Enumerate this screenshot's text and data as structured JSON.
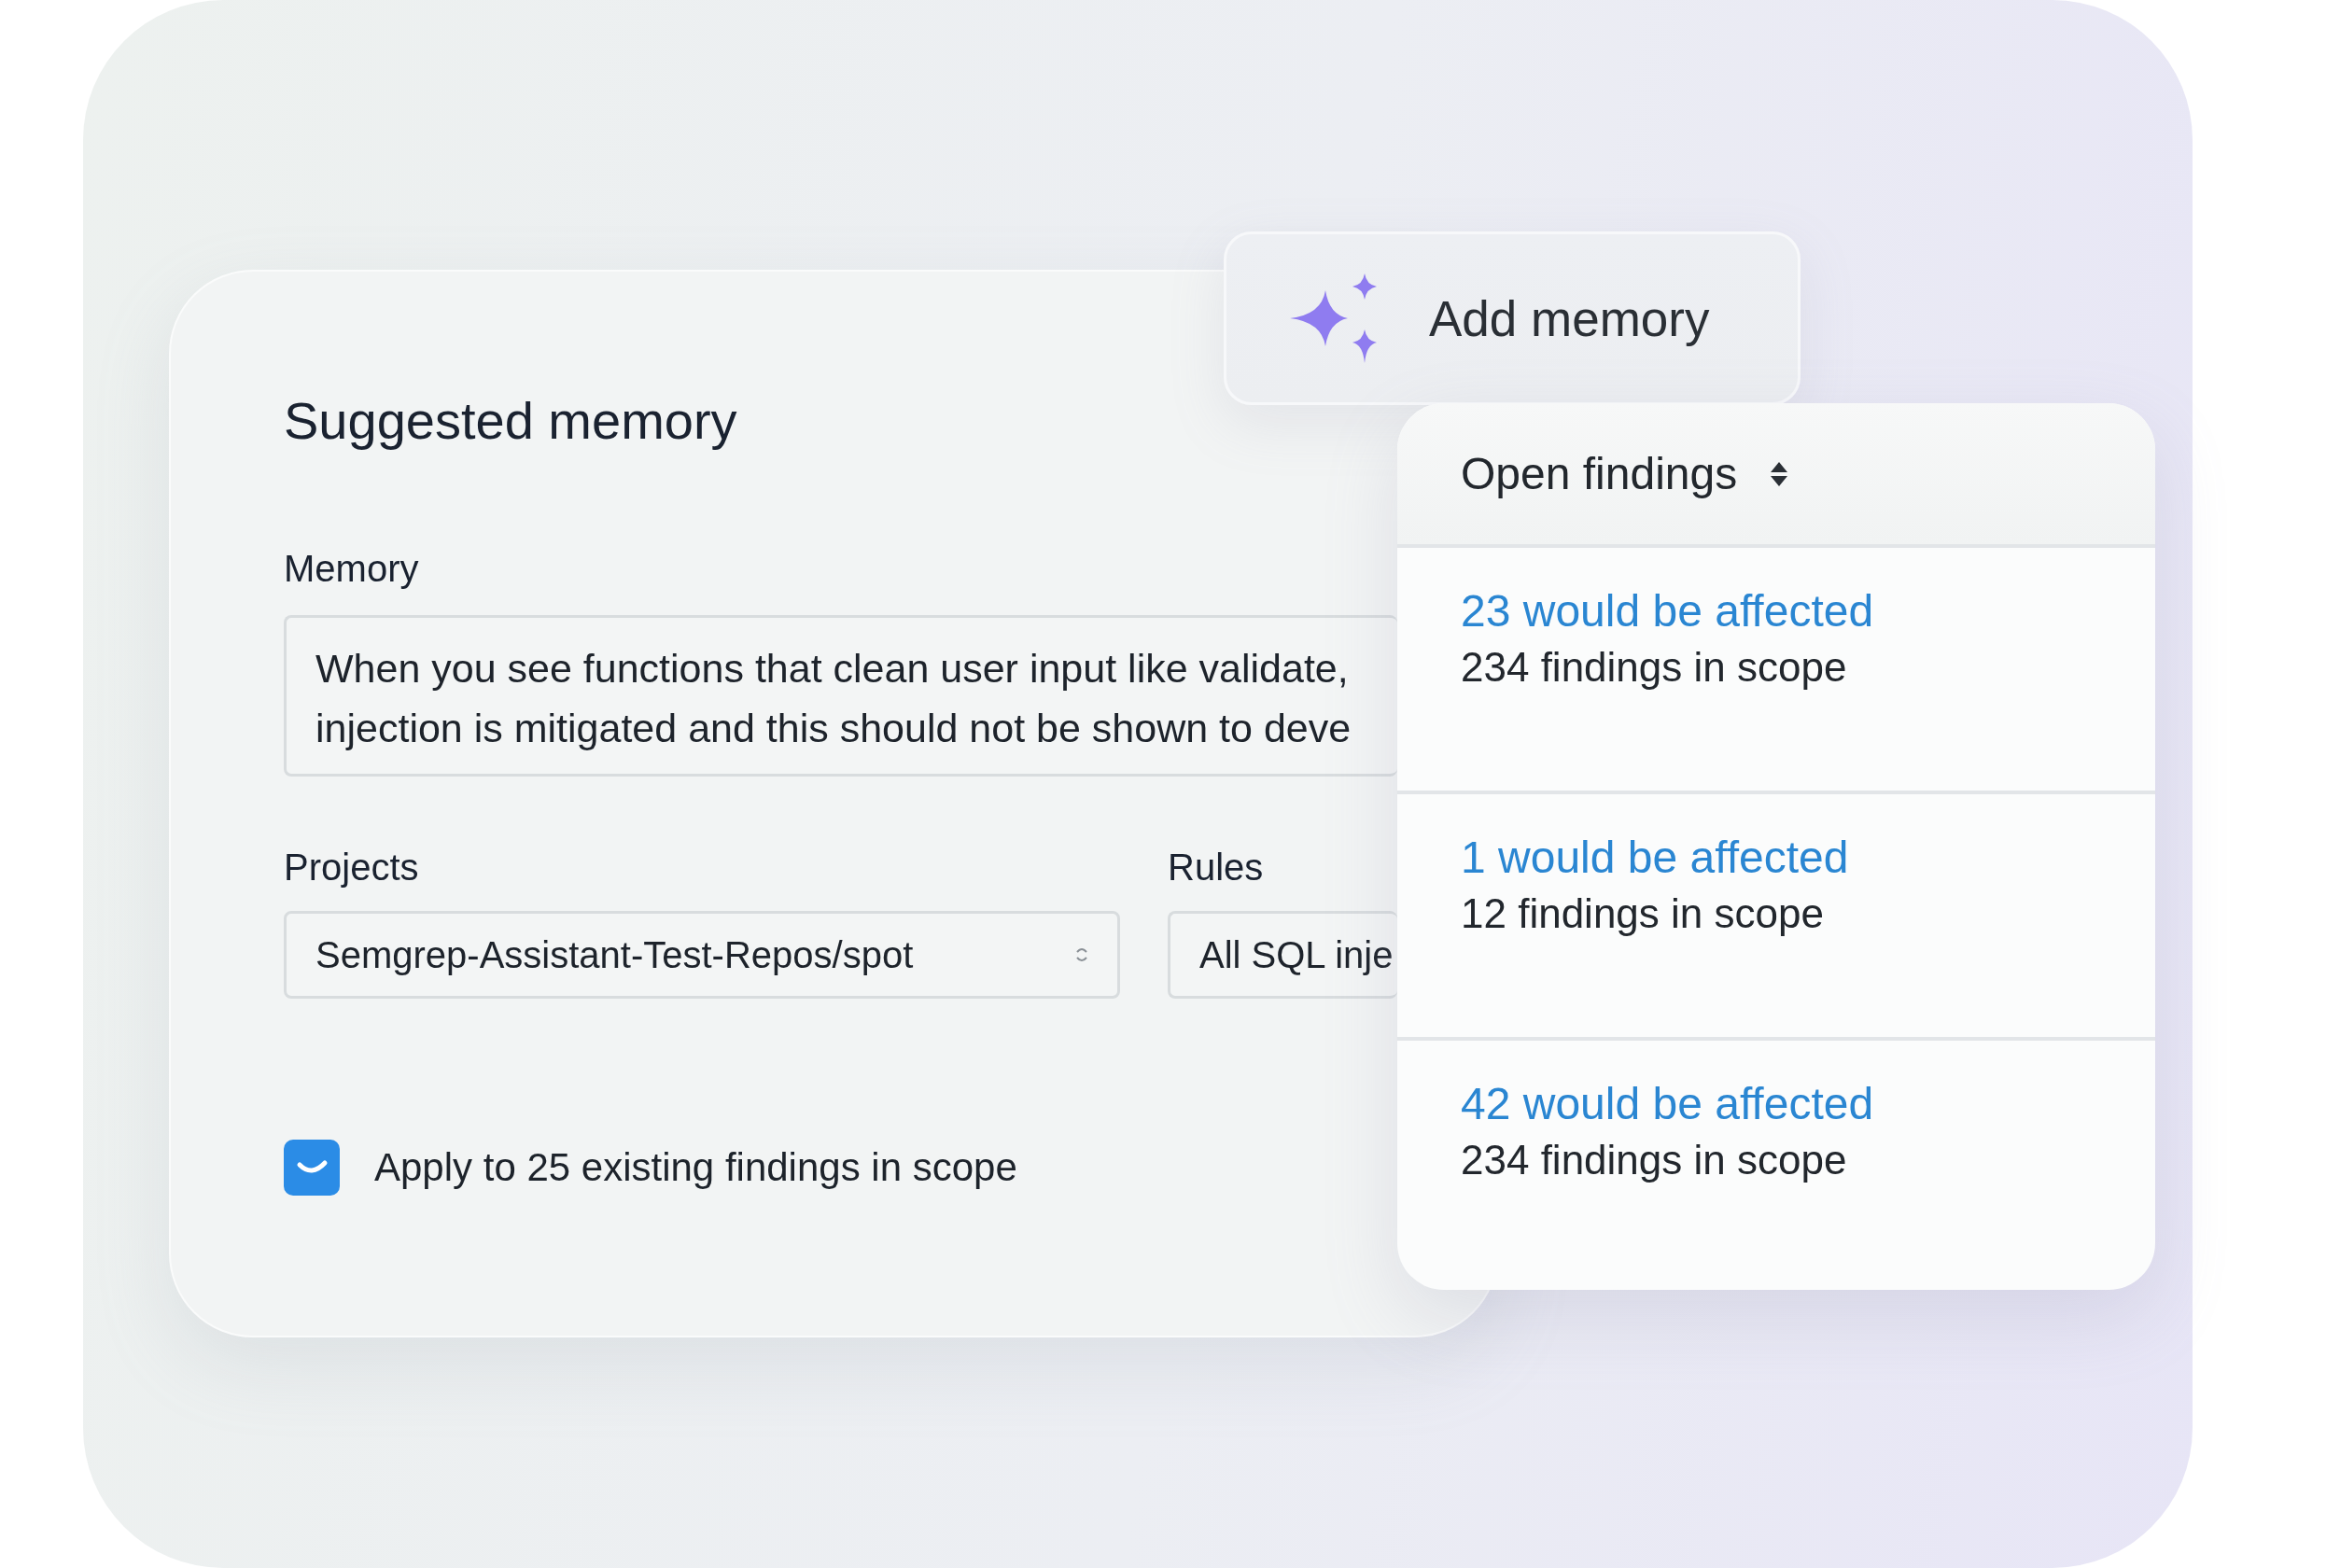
{
  "suggested_memory": {
    "title": "Suggested memory",
    "memory_label": "Memory",
    "memory_lines": [
      "When you see functions that clean user input like validate,",
      "injection is mitigated and this should not be shown to deve"
    ],
    "projects_label": "Projects",
    "project_value": "Semgrep-Assistant-Test-Repos/spot",
    "rules_label": "Rules",
    "rules_value": "All SQL inje",
    "apply": {
      "checked": true,
      "label": "Apply to 25 existing findings in scope"
    }
  },
  "add_memory": {
    "label": "Add memory"
  },
  "findings_panel": {
    "filter": "Open findings",
    "rows": [
      {
        "affected": "23 would be affected",
        "scope": "234 findings in scope"
      },
      {
        "affected": "1 would be affected",
        "scope": "12 findings in scope"
      },
      {
        "affected": "42 would be affected",
        "scope": "234 findings in scope"
      }
    ]
  }
}
